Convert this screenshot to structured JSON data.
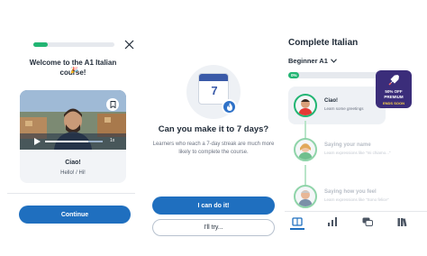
{
  "colors": {
    "accent_blue": "#1f6fbf",
    "progress_green": "#22b573",
    "promo_purple": "#3b2d7a",
    "text_dark": "#1f2a37",
    "text_muted": "#6b7280"
  },
  "onboarding": {
    "progress_fraction": 0.18,
    "welcome_text": "Welcome to the A1 Italian course!",
    "party_emoji": "🎉",
    "lesson_card": {
      "title": "Ciao!",
      "subtitle": "Hello! / Hi!",
      "video_playback_fraction": 0.75,
      "speed": "1x"
    },
    "continue_label": "Continue"
  },
  "streak": {
    "calendar_day": "7",
    "question": "Can you make it to 7 days?",
    "explanation": "Learners who reach a 7-day streak are much more likely to complete the course.",
    "primary_label": "I can do it!",
    "secondary_label": "I'll try..."
  },
  "course": {
    "title": "Complete Italian",
    "level": "Beginner A1",
    "progress_label": "0%",
    "progress_fraction": 0.05,
    "promo": {
      "discount": "50% OFF",
      "plan": "PREMIUM",
      "cta": "ENDS SOON"
    },
    "lessons": [
      {
        "name": "Ciao!",
        "description": "Learn some greetings"
      },
      {
        "name": "Saying your name",
        "description": "Learn expressions like \"mi chiamo...\""
      },
      {
        "name": "Saying how you feel",
        "description": "Learn expressions like \"Sono felice\""
      }
    ],
    "tabs": [
      "book-icon",
      "chart-icon",
      "chat-icon",
      "library-icon"
    ]
  }
}
